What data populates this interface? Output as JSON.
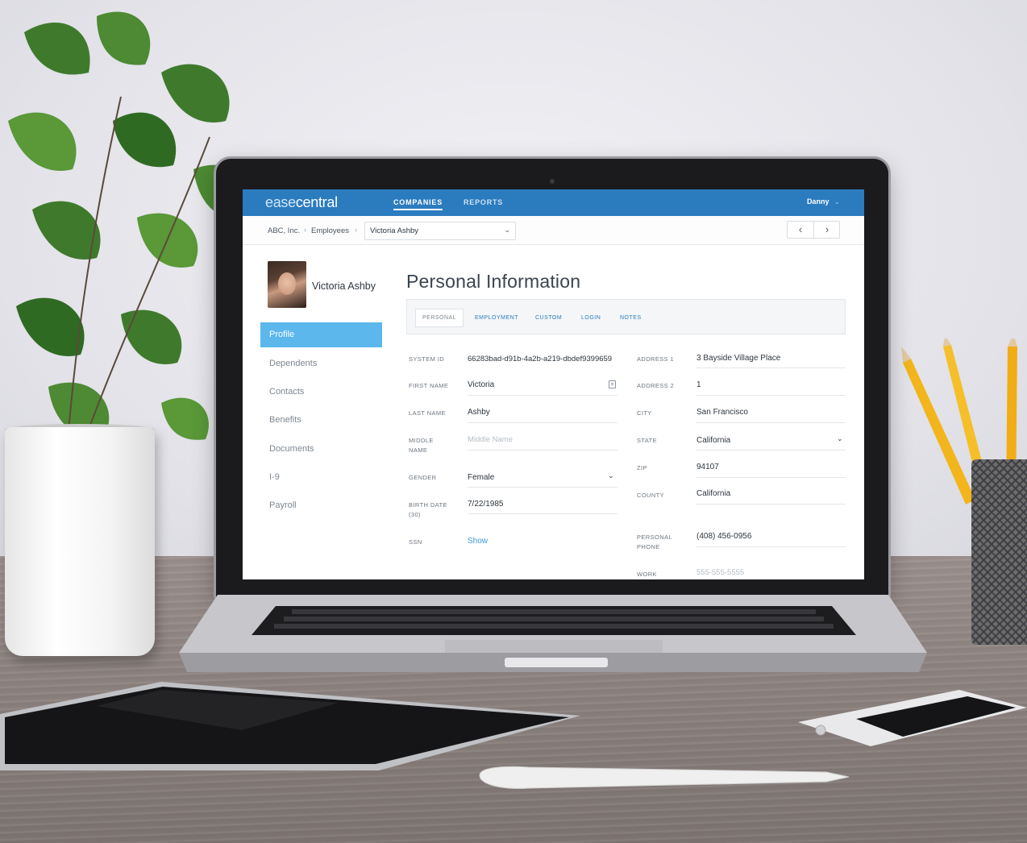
{
  "app": {
    "logo_prefix": "ease",
    "logo_suffix": "central",
    "nav": [
      "COMPANIES",
      "REPORTS"
    ],
    "user": "Danny"
  },
  "breadcrumb": {
    "company": "ABC, Inc.",
    "section": "Employees",
    "employee_select": "Victoria Ashby"
  },
  "profile": {
    "name": "Victoria Ashby",
    "menu": [
      "Profile",
      "Dependents",
      "Contacts",
      "Benefits",
      "Documents",
      "I-9",
      "Payroll"
    ],
    "active_menu": "Profile"
  },
  "page": {
    "title": "Personal Information",
    "tabs": [
      "PERSONAL",
      "EMPLOYMENT",
      "CUSTOM",
      "LOGIN",
      "NOTES"
    ],
    "active_tab": "PERSONAL"
  },
  "left_fields": {
    "system_id": {
      "label": "SYSTEM ID",
      "value": "66283bad-d91b-4a2b-a219-dbdef9399659"
    },
    "first_name": {
      "label": "FIRST NAME",
      "value": "Victoria"
    },
    "last_name": {
      "label": "LAST NAME",
      "value": "Ashby"
    },
    "middle_name": {
      "label_1": "MIDDLE",
      "label_2": "NAME",
      "placeholder": "Middle Name"
    },
    "gender": {
      "label": "GENDER",
      "value": "Female"
    },
    "birth_date": {
      "label_1": "BIRTH DATE",
      "label_2": "(30)",
      "value": "7/22/1985"
    },
    "ssn": {
      "label": "SSN",
      "value": "Show"
    }
  },
  "right_fields": {
    "address1": {
      "label": "ADDRESS 1",
      "value": "3 Bayside Village Place"
    },
    "address2": {
      "label": "ADDRESS 2",
      "value": "1"
    },
    "city": {
      "label": "CITY",
      "value": "San Francisco"
    },
    "state": {
      "label": "STATE",
      "value": "California"
    },
    "zip": {
      "label": "ZIP",
      "value": "94107"
    },
    "county": {
      "label": "COUNTY",
      "value": "California"
    },
    "personal_phone": {
      "label_1": "PERSONAL",
      "label_2": "PHONE",
      "value": "(408) 456-0956"
    },
    "work": {
      "label": "WORK",
      "placeholder": "555-555-5555"
    }
  },
  "colors": {
    "topbar": "#2b7bbf",
    "active_menu": "#5bb7ec",
    "link": "#3b9be0"
  }
}
